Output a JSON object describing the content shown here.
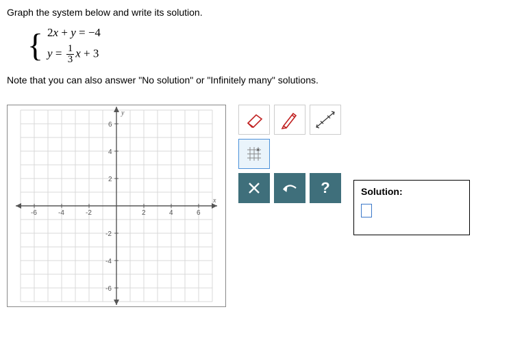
{
  "prompt": "Graph the system below and write its solution.",
  "equations": {
    "eq1_lhs": "2x + y",
    "eq1_rhs": "−4",
    "eq2_lhs": "y",
    "eq2_frac_num": "1",
    "eq2_frac_den": "3",
    "eq2_after": "x + 3"
  },
  "note": "Note that you can also answer \"No solution\" or \"Infinitely many\" solutions.",
  "axes": {
    "x": "x",
    "y": "y"
  },
  "ticks": {
    "xneg": [
      "-6",
      "-4",
      "-2"
    ],
    "xpos": [
      "2",
      "4",
      "6"
    ],
    "ypos": [
      "2",
      "4",
      "6"
    ],
    "yneg": [
      "-2",
      "-4",
      "-6"
    ]
  },
  "tools": {
    "eraser": "eraser-icon",
    "pen": "pen-icon",
    "line": "line-tool-icon",
    "point": "point-tool-icon",
    "clear": "clear-icon",
    "undo": "undo-icon",
    "help": "?"
  },
  "solution": {
    "label": "Solution:",
    "value": ""
  },
  "chart_data": {
    "type": "line",
    "title": "",
    "xlabel": "x",
    "ylabel": "y",
    "xlim": [
      -7,
      7
    ],
    "ylim": [
      -7,
      7
    ],
    "x_ticks": [
      -6,
      -4,
      -2,
      0,
      2,
      4,
      6
    ],
    "y_ticks": [
      -6,
      -4,
      -2,
      0,
      2,
      4,
      6
    ],
    "grid": true,
    "series": [
      {
        "name": "2x + y = -4",
        "equation": "y = -2x - 4",
        "plotted": false
      },
      {
        "name": "y = (1/3)x + 3",
        "equation": "y = (1/3)x + 3",
        "plotted": false
      }
    ]
  }
}
